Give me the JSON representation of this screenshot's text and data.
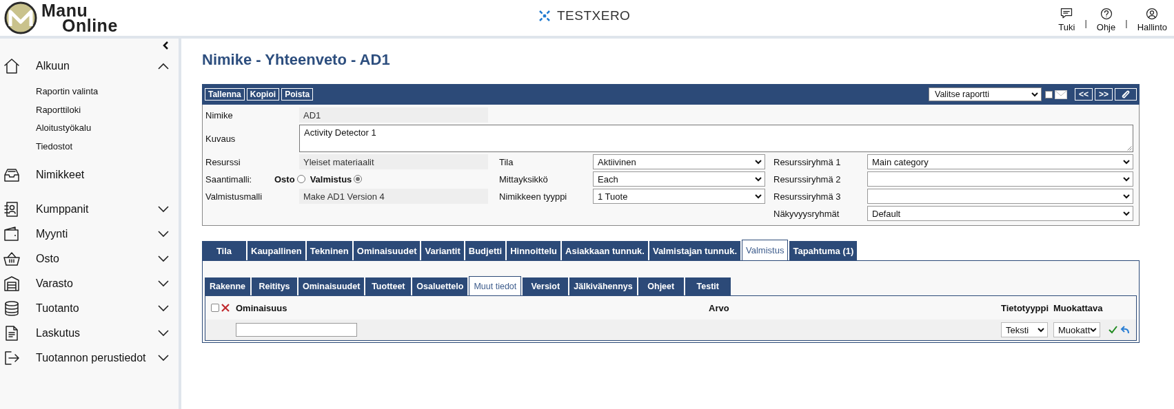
{
  "header": {
    "logo": {
      "line1": "Manu",
      "line2": "Online"
    },
    "tenant": "TESTXERO",
    "separator": "|",
    "links": [
      {
        "label": "Tuki"
      },
      {
        "label": "Ohje"
      },
      {
        "label": "Hallinto"
      }
    ]
  },
  "sidebar": {
    "items": [
      {
        "label": "Alkuun",
        "kind": "group",
        "expanded": true,
        "children": [
          {
            "label": "Raportin valinta"
          },
          {
            "label": "Raporttiloki"
          },
          {
            "label": "Aloitustyökalu"
          },
          {
            "label": "Tiedostot"
          }
        ]
      },
      {
        "label": "Nimikkeet",
        "kind": "link"
      },
      {
        "label": "Kumppanit",
        "kind": "group",
        "expanded": false
      },
      {
        "label": "Myynti",
        "kind": "group",
        "expanded": false
      },
      {
        "label": "Osto",
        "kind": "group",
        "expanded": false
      },
      {
        "label": "Varasto",
        "kind": "group",
        "expanded": false
      },
      {
        "label": "Tuotanto",
        "kind": "group",
        "expanded": false
      },
      {
        "label": "Laskutus",
        "kind": "group",
        "expanded": false
      },
      {
        "label": "Tuotannon perustiedot",
        "kind": "group",
        "expanded": false
      }
    ]
  },
  "page": {
    "title": "Nimike - Yhteenveto - AD1"
  },
  "toolbar": {
    "buttons": [
      "Tallenna",
      "Kopioi",
      "Poista"
    ],
    "report_select": "Valitse raportti",
    "email_checkbox": {
      "checked": false
    },
    "nav_buttons": [
      "<<",
      ">>"
    ]
  },
  "form": {
    "top": [
      {
        "label": "Nimike",
        "kind": "readonly",
        "value": "AD1"
      },
      {
        "label": "Kuvaus",
        "kind": "textarea",
        "value": "Activity Detector 1"
      }
    ],
    "columns": [
      [
        {
          "label": "Resurssi",
          "kind": "readonly",
          "value": "Yleiset materiaalit"
        },
        {
          "label": "Saantimalli:",
          "kind": "radio",
          "options": [
            {
              "label": "Osto",
              "selected": false
            },
            {
              "label": "Valmistus",
              "selected": true
            }
          ]
        },
        {
          "label": "Valmistusmalli",
          "kind": "readonly",
          "value": "Make AD1 Version 4"
        }
      ],
      [
        {
          "label": "Tila",
          "kind": "select",
          "value": "Aktiivinen"
        },
        {
          "label": "Mittayksikkö",
          "kind": "select",
          "value": "Each"
        },
        {
          "label": "Nimikkeen tyyppi",
          "kind": "select",
          "value": "1 Tuote"
        }
      ],
      [
        {
          "label": "Resurssiryhmä 1",
          "kind": "select",
          "value": "Main category"
        },
        {
          "label": "Resurssiryhmä 2",
          "kind": "select"
        },
        {
          "label": "Resurssiryhmä 3",
          "kind": "select"
        },
        {
          "label": "Näkyvyysryhmät",
          "kind": "select",
          "value": "Default"
        }
      ]
    ]
  },
  "tabs": [
    {
      "label": "Tila",
      "selected": false
    },
    {
      "label": "Kaupallinen",
      "selected": false
    },
    {
      "label": "Tekninen",
      "selected": false
    },
    {
      "label": "Ominaisuudet",
      "selected": false
    },
    {
      "label": "Variantit",
      "selected": false
    },
    {
      "label": "Budjetti",
      "selected": false
    },
    {
      "label": "Hinnoittelu",
      "selected": false
    },
    {
      "label": "Asiakkaan tunnuk.",
      "selected": false
    },
    {
      "label": "Valmistajan tunnuk.",
      "selected": false
    },
    {
      "label": "Valmistus",
      "selected": true
    },
    {
      "label": "Tapahtuma (1)",
      "selected": false
    }
  ],
  "subtabs": [
    {
      "label": "Rakenne",
      "selected": false
    },
    {
      "label": "Reititys",
      "selected": false
    },
    {
      "label": "Ominaisuudet",
      "selected": false
    },
    {
      "label": "Tuotteet",
      "selected": false
    },
    {
      "label": "Osaluettelo",
      "selected": false
    },
    {
      "label": "Muut tiedot",
      "selected": true
    },
    {
      "label": "Versiot",
      "selected": false
    },
    {
      "label": "Jälkivähennys",
      "selected": false
    },
    {
      "label": "Ohjeet",
      "selected": false
    },
    {
      "label": "Testit",
      "selected": false
    }
  ],
  "table": {
    "select_all": {
      "checked": false
    },
    "columns": [
      "Ominaisuus",
      "Arvo",
      "Tietotyyppi",
      "Muokattava"
    ],
    "new_row": {
      "data_type": "Teksti",
      "editable": "Muokatt"
    }
  }
}
